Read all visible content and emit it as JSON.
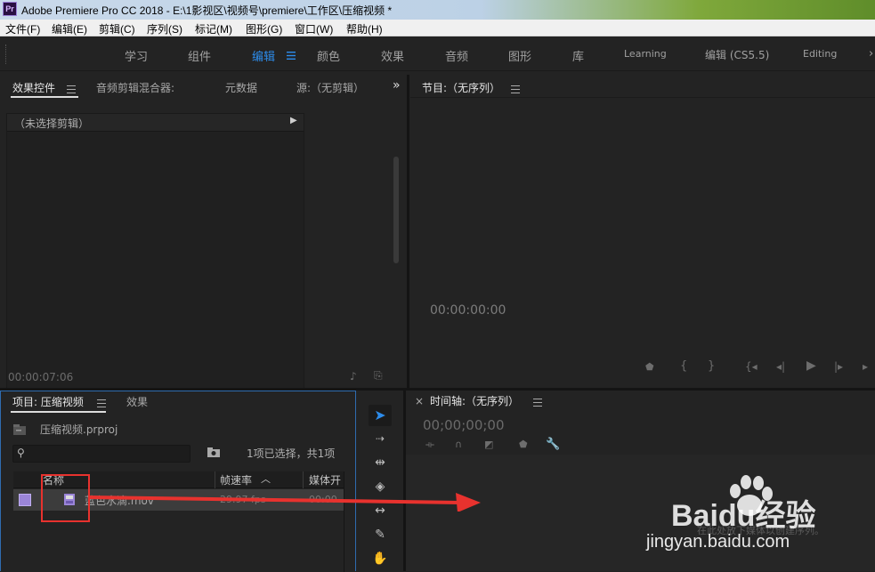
{
  "titlebar": {
    "logo": "Pr",
    "title": "Adobe Premiere Pro CC 2018 - E:\\1影视区\\视频号\\premiere\\工作区\\压缩视频 *"
  },
  "menubar": [
    "文件(F)",
    "编辑(E)",
    "剪辑(C)",
    "序列(S)",
    "标记(M)",
    "图形(G)",
    "窗口(W)",
    "帮助(H)"
  ],
  "workspaces": [
    "学习",
    "组件",
    "编辑",
    "颜色",
    "效果",
    "音频",
    "图形",
    "库",
    "Learning",
    "编辑 (CS5.5)",
    "Editing"
  ],
  "active_workspace": "编辑",
  "source_panel": {
    "tabs": [
      "效果控件",
      "音频剪辑混合器:",
      "元数据",
      "源:（无剪辑）"
    ],
    "no_clip": "（未选择剪辑）",
    "timecode": "00:00:07:06"
  },
  "program_monitor": {
    "title": "节目:（无序列）",
    "timecode": "00:00:00:00"
  },
  "project_panel": {
    "tabs": [
      "项目: 压缩视频",
      "效果"
    ],
    "project_file": "压缩视频.prproj",
    "selection_status": "1项已选择，共1项",
    "columns": [
      "名称",
      "帧速率",
      "媒体开"
    ],
    "rows": [
      {
        "name": "蓝色水滴.mov",
        "fps": "29.97 fps",
        "media_start": "00:00"
      }
    ]
  },
  "timeline": {
    "title": "时间轴:（无序列）",
    "close": "×",
    "timecode": "00;00;00;00",
    "drop_hint": "在此处放下媒体以创建序列。"
  },
  "watermark": {
    "logo_text": "Baidu经验",
    "url": "jingyan.baidu.com"
  },
  "colors": {
    "accent": "#2d8ceb",
    "label_purple": "#9b85d8",
    "annotation_red": "#e8322e"
  }
}
